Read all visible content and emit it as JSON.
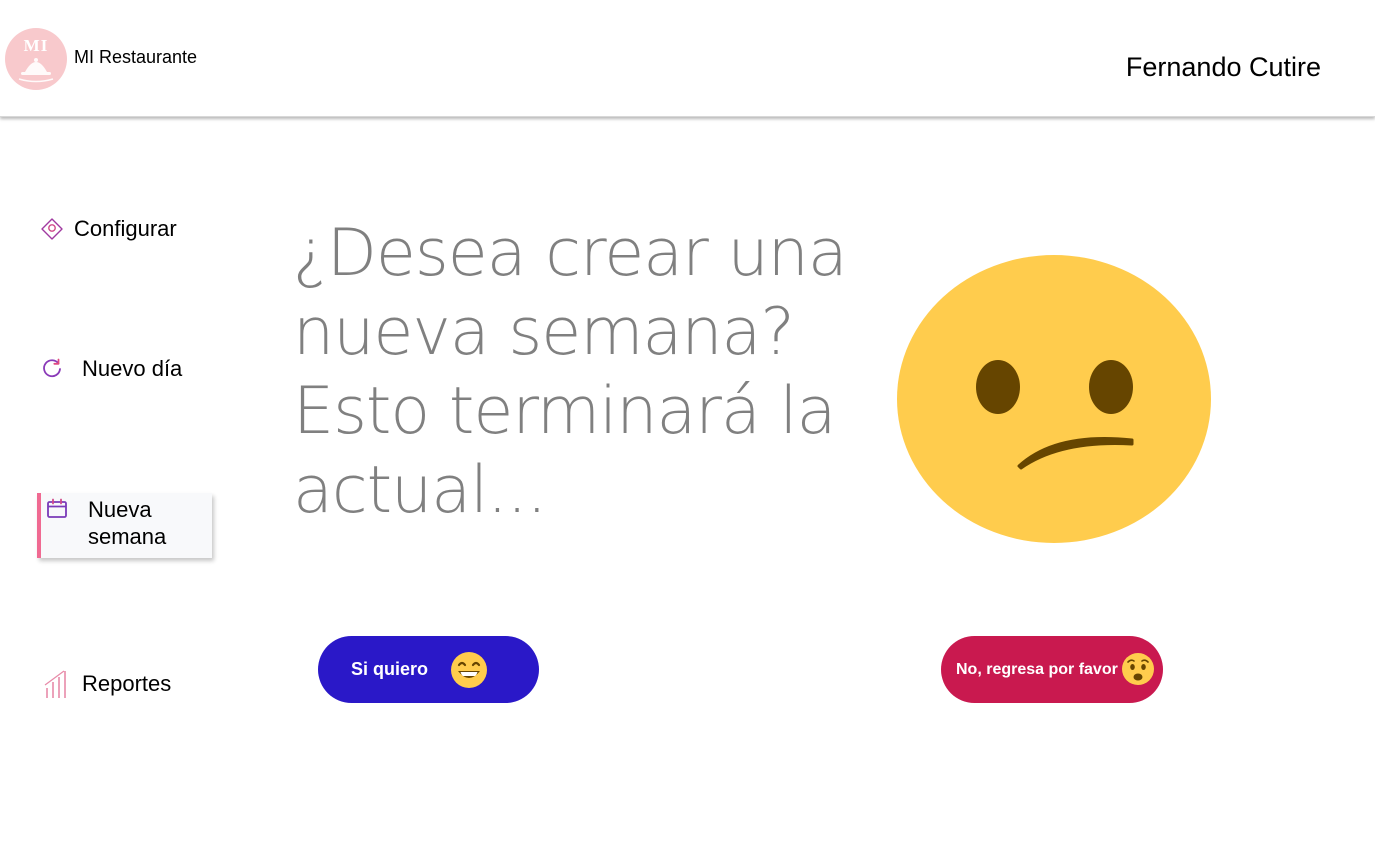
{
  "header": {
    "logo_text": "MI",
    "app_title": "MI Restaurante",
    "user_name": "Fernando Cutire"
  },
  "sidebar": {
    "items": [
      {
        "label": "Configurar",
        "icon": "gear-diamond-icon",
        "active": false
      },
      {
        "label": "Nuevo día",
        "icon": "refresh-icon",
        "active": false
      },
      {
        "label": "Nueva semana",
        "icon": "calendar-icon",
        "active": true
      },
      {
        "label": "Reportes",
        "icon": "bar-chart-icon",
        "active": false
      }
    ]
  },
  "main": {
    "question": "¿Desea crear una nueva semana? Esto terminará la actual...",
    "illustration_icon": "confused-face-icon",
    "confirm_button": {
      "label": "Si quiero",
      "icon": "grinning-face-icon"
    },
    "cancel_button": {
      "label": "No, regresa por favor",
      "icon": "worried-face-icon"
    }
  },
  "colors": {
    "accent_blue": "#2a18c8",
    "accent_red": "#c9194f",
    "active_indicator": "#f06a92",
    "logo_bg": "#f8c9cc",
    "emoji_yellow": "#ffcc4d",
    "question_gray": "#808080"
  }
}
